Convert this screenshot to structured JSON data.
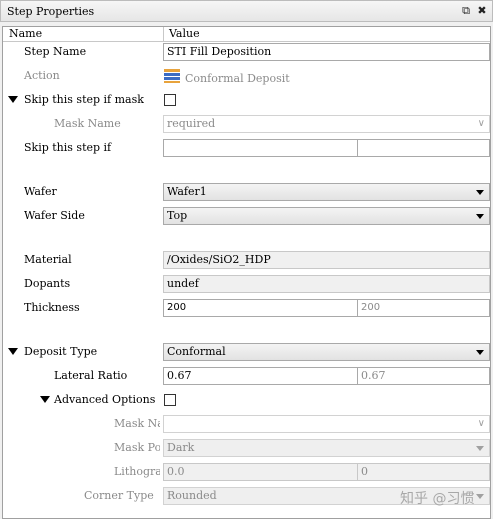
{
  "window": {
    "title": "Step Properties"
  },
  "columns": {
    "name": "Name",
    "value": "Value"
  },
  "step_name": {
    "label": "Step Name",
    "value": "STI Fill Deposition"
  },
  "action": {
    "label": "Action",
    "value": "Conformal Deposit",
    "icon": "layer-stack-icon"
  },
  "skip_if_mask": {
    "label": "Skip this step if mask",
    "checked": false
  },
  "mask_name": {
    "label": "Mask Name",
    "placeholder": "required"
  },
  "skip_if": {
    "label": "Skip this step if",
    "value1": "",
    "value2": ""
  },
  "wafer": {
    "label": "Wafer",
    "value": "Wafer1"
  },
  "wafer_side": {
    "label": "Wafer Side",
    "value": "Top"
  },
  "material": {
    "label": "Material",
    "value": "/Oxides/SiO2_HDP"
  },
  "dopants": {
    "label": "Dopants",
    "value": "undef"
  },
  "thickness": {
    "label": "Thickness",
    "value": "200",
    "computed": "200"
  },
  "deposit_type": {
    "label": "Deposit Type",
    "value": "Conformal"
  },
  "lateral_ratio": {
    "label": "Lateral Ratio",
    "value": "0.67",
    "computed": "0.67"
  },
  "advanced_options": {
    "label": "Advanced Options",
    "checked": false
  },
  "adv_mask_name": {
    "label": "Mask Nam",
    "value": ""
  },
  "mask_polarity": {
    "label": "Mask Pol",
    "value": "Dark"
  },
  "lithography": {
    "label": "Lithogra",
    "value": "0.0",
    "computed": "0"
  },
  "corner_type": {
    "label": "Corner Type",
    "value": "Rounded"
  },
  "watermark": "知乎 @习惯"
}
